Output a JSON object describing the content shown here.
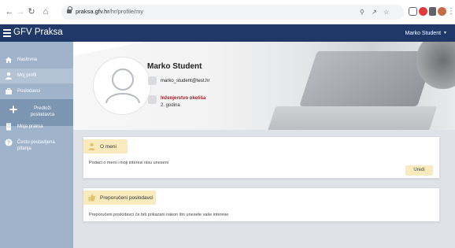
{
  "browser": {
    "url_host": "praksa.gfv.hr",
    "url_path": "/hr/profile/my"
  },
  "header": {
    "app_title": "GFV Praksa",
    "user_name": "Marko Student"
  },
  "sidebar": {
    "items": [
      {
        "label": "Naslovna",
        "icon": "home-icon"
      },
      {
        "label": "Moj profil",
        "icon": "user-icon"
      },
      {
        "label": "Poslodavci",
        "icon": "briefcase-icon"
      },
      {
        "label": "Predloži poslodavca",
        "icon": "plus-icon"
      },
      {
        "label": "Moja praksa",
        "icon": "building-icon"
      },
      {
        "label": "Često postavljena pitanja",
        "icon": "question-icon"
      }
    ]
  },
  "profile": {
    "name": "Marko Student",
    "email": "marko_student@test.hr",
    "study_program": "Inženjerstvo okoliša",
    "study_year": "2. godina"
  },
  "about_card": {
    "title": "O meni",
    "text": "Podaci o meni i moji interesi nisu uneseni",
    "edit_label": "Uredi"
  },
  "employers_card": {
    "title": "Preporučeni poslodavci",
    "text": "Preporučeni poslodavci će biti prikazani nakon što unesete vaše interese"
  },
  "colors": {
    "header_bg": "#1f3867",
    "sidebar_bg": "#9fb4cb",
    "card_accent": "#f9ebbd",
    "study_color": "#9c1f2a"
  }
}
